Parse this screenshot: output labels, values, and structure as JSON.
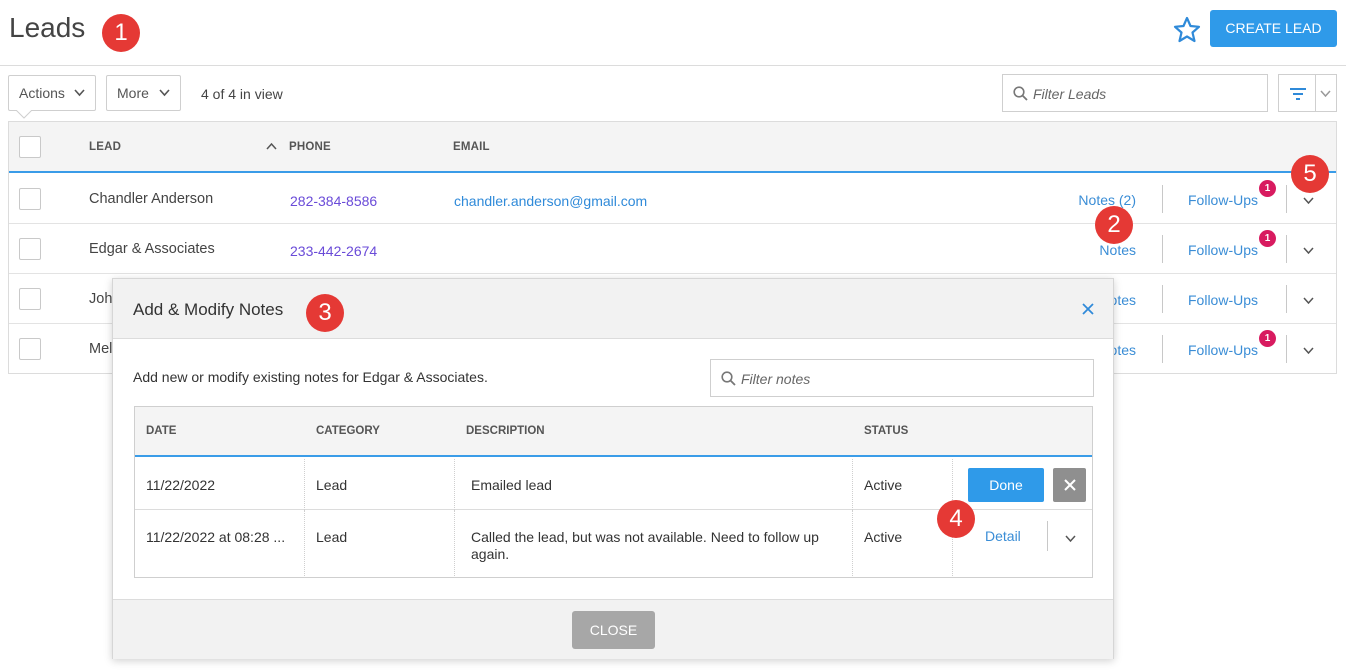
{
  "header": {
    "title": "Leads",
    "create_label": "CREATE LEAD"
  },
  "callouts": [
    "1",
    "2",
    "3",
    "4",
    "5"
  ],
  "toolbar": {
    "actions_label": "Actions",
    "more_label": "More",
    "view_count": "4 of 4 in view",
    "filter_placeholder": "Filter Leads"
  },
  "leads": {
    "columns": [
      "LEAD",
      "PHONE",
      "EMAIL"
    ],
    "rows": [
      {
        "name": "Chandler Anderson",
        "phone": "282-384-8586",
        "email": "chandler.anderson@gmail.com",
        "notes": "Notes (2)",
        "followups": "Follow-Ups",
        "badge": "1"
      },
      {
        "name": "Edgar & Associates",
        "phone": "233-442-2674",
        "email": "",
        "notes": "Notes",
        "followups": "Follow-Ups",
        "badge": "1"
      },
      {
        "name": "John",
        "phone": "",
        "email": "",
        "notes": "Notes",
        "followups": "Follow-Ups",
        "badge": ""
      },
      {
        "name": "Mel",
        "phone": "",
        "email": "",
        "notes": "Notes",
        "followups": "Follow-Ups",
        "badge": "1"
      }
    ]
  },
  "modal": {
    "title": "Add & Modify Notes",
    "description": "Add new or modify existing notes for Edgar & Associates.",
    "filter_placeholder": "Filter notes",
    "columns": [
      "DATE",
      "CATEGORY",
      "DESCRIPTION",
      "STATUS"
    ],
    "rows": [
      {
        "date": "11/22/2022",
        "category": "Lead",
        "description": "Emailed lead",
        "status": "Active",
        "done_label": "Done"
      },
      {
        "date": "11/22/2022 at 08:28 ...",
        "category": "Lead",
        "description_line1": "Called the lead, but was not available. Need to follow up",
        "description_line2": "again.",
        "status": "Active",
        "detail_label": "Detail"
      }
    ],
    "close_label": "CLOSE"
  },
  "colors": {
    "accent": "#2f9ae9",
    "callout": "#e53935",
    "badge": "#d81b60",
    "phone": "#6a4bd8"
  }
}
